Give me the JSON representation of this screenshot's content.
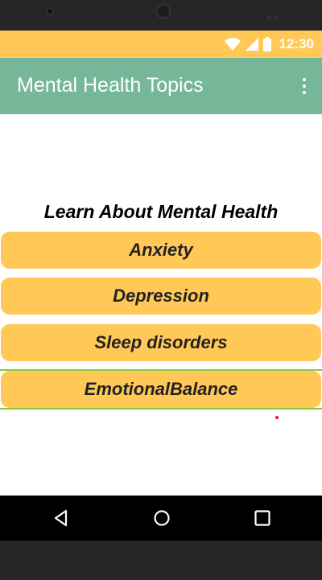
{
  "status_bar": {
    "time": "12:30",
    "icons": [
      "wifi-icon",
      "signal-icon",
      "battery-icon"
    ]
  },
  "app_bar": {
    "title": "Mental Health Topics",
    "menu_icon": "overflow-menu-icon"
  },
  "main": {
    "heading": "Learn About Mental Health",
    "topics": [
      {
        "label": "Anxiety"
      },
      {
        "label": "Depression"
      },
      {
        "label": "Sleep disorders"
      },
      {
        "label": "EmotionalBalance"
      }
    ]
  },
  "nav_bar": {
    "buttons": [
      "back-icon",
      "home-icon",
      "recents-icon"
    ]
  },
  "colors": {
    "status_bar": "#ffc857",
    "app_bar": "#76b799",
    "button": "#ffc857",
    "accent_line": "#8cc63f"
  }
}
